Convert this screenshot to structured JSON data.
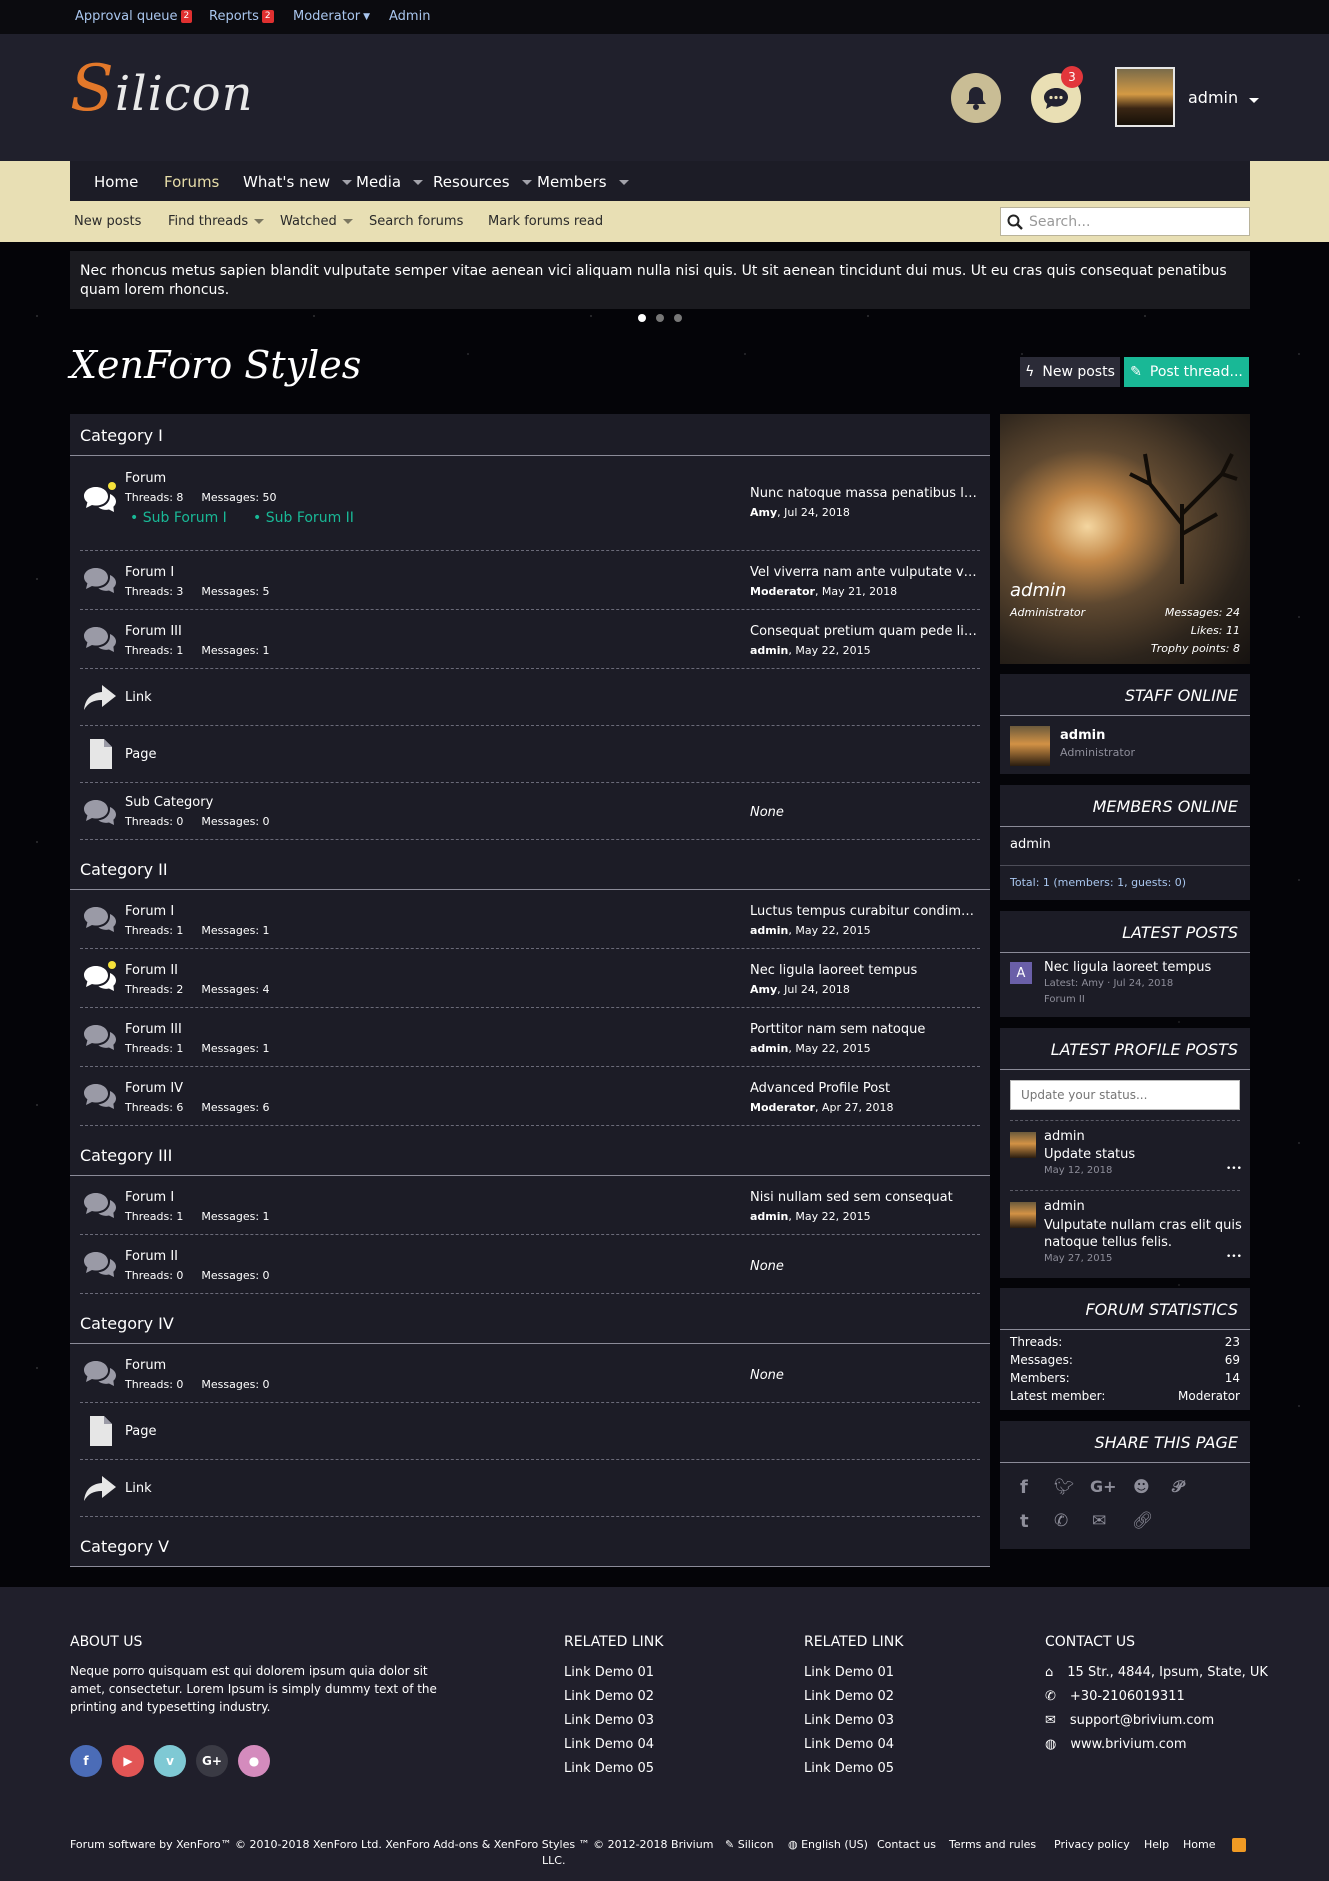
{
  "staffbar": {
    "approval_queue": "Approval queue",
    "approval_count": "2",
    "reports": "Reports",
    "reports_count": "2",
    "moderator": "Moderator",
    "admin": "Admin"
  },
  "header": {
    "logo_first": "S",
    "logo_rest": "ilicon",
    "notification_count": "3",
    "username": "admin"
  },
  "nav": {
    "home": "Home",
    "forums": "Forums",
    "whats_new": "What's new",
    "media": "Media",
    "resources": "Resources",
    "members": "Members"
  },
  "subnav": {
    "new_posts": "New posts",
    "find_threads": "Find threads",
    "watched": "Watched",
    "search_forums": "Search forums",
    "mark_read": "Mark forums read",
    "search_placeholder": "Search..."
  },
  "notice": "Nec rhoncus metus sapien blandit vulputate semper vitae aenean vici aliquam nulla nisi quis. Ut sit aenean tincidunt dui mus. Ut eu cras quis consequat penatibus quam lorem rhoncus.",
  "page": {
    "title": "XenForo Styles",
    "btn_new_posts": "New posts",
    "btn_post_thread": "Post thread..."
  },
  "categories": {
    "c1": "Category I",
    "c2": "Category II",
    "c3": "Category III",
    "c4": "Category IV",
    "c5": "Category V"
  },
  "nodes": {
    "n1": {
      "title": "Forum",
      "threads": "Threads: 8",
      "messages": "Messages: 50",
      "last": "Nunc natoque massa penatibus lorem",
      "user": "Amy",
      "date": ", Jul 24, 2018",
      "sub1": "Sub Forum I",
      "sub2": "Sub Forum II"
    },
    "n2": {
      "title": "Forum I",
      "threads": "Threads: 3",
      "messages": "Messages: 5",
      "last": "Vel viverra nam ante vulputate venenatis",
      "user": "Moderator",
      "date": ", May 21, 2018"
    },
    "n3": {
      "title": "Forum III",
      "threads": "Threads: 1",
      "messages": "Messages: 1",
      "last": "Consequat pretium quam pede libero",
      "user": "admin",
      "date": ", May 22, 2015"
    },
    "n4": {
      "title": "Link"
    },
    "n5": {
      "title": "Page"
    },
    "n6": {
      "title": "Sub Category",
      "threads": "Threads: 0",
      "messages": "Messages: 0",
      "none": "None"
    },
    "n7": {
      "title": "Forum I",
      "threads": "Threads: 1",
      "messages": "Messages: 1",
      "last": "Luctus tempus curabitur condimentum",
      "user": "admin",
      "date": ", May 22, 2015"
    },
    "n8": {
      "title": "Forum II",
      "threads": "Threads: 2",
      "messages": "Messages: 4",
      "last": "Nec ligula laoreet tempus",
      "user": "Amy",
      "date": ", Jul 24, 2018"
    },
    "n9": {
      "title": "Forum III",
      "threads": "Threads: 1",
      "messages": "Messages: 1",
      "last": "Porttitor nam sem natoque",
      "user": "admin",
      "date": ", May 22, 2015"
    },
    "n10": {
      "title": "Forum IV",
      "threads": "Threads: 6",
      "messages": "Messages: 6",
      "last": "Advanced Profile Post",
      "user": "Moderator",
      "date": ", Apr 27, 2018"
    },
    "n11": {
      "title": "Forum I",
      "threads": "Threads: 1",
      "messages": "Messages: 1",
      "last": "Nisi nullam sed sem consequat",
      "user": "admin",
      "date": ", May 22, 2015"
    },
    "n12": {
      "title": "Forum II",
      "threads": "Threads: 0",
      "messages": "Messages: 0",
      "none": "None"
    },
    "n13": {
      "title": "Forum",
      "threads": "Threads: 0",
      "messages": "Messages: 0",
      "none": "None"
    },
    "n14": {
      "title": "Page"
    },
    "n15": {
      "title": "Link"
    }
  },
  "profile_card": {
    "name": "admin",
    "role": "Administrator",
    "messages": "Messages: 24",
    "likes": "Likes: 11",
    "trophy": "Trophy points: 8"
  },
  "staff_online": {
    "title": "STAFF ONLINE",
    "name": "admin",
    "role": "Administrator"
  },
  "members_online": {
    "title": "MEMBERS ONLINE",
    "member": "admin",
    "total": "Total: 1 (members: 1, guests: 0)"
  },
  "latest_posts": {
    "title": "LATEST POSTS",
    "avatar_letter": "A",
    "post_title": "Nec ligula laoreet tempus",
    "meta": "Latest: Amy · Jul 24, 2018",
    "forum": "Forum II"
  },
  "latest_profile_posts": {
    "title": "LATEST PROFILE POSTS",
    "placeholder": "Update your status...",
    "p1": {
      "user": "admin",
      "text": "Update status",
      "date": "May 12, 2018"
    },
    "p2": {
      "user": "admin",
      "text1": "Vulputate nullam cras elit quis",
      "text2": "natoque tellus felis.",
      "date": "May 27, 2015"
    },
    "more": "•••"
  },
  "forum_stats": {
    "title": "FORUM STATISTICS",
    "threads_label": "Threads:",
    "threads": "23",
    "messages_label": "Messages:",
    "messages": "69",
    "members_label": "Members:",
    "members": "14",
    "latest_label": "Latest member:",
    "latest": "Moderator"
  },
  "share": {
    "title": "SHARE THIS PAGE"
  },
  "footer": {
    "about_title": "ABOUT US",
    "about_l1": "Neque porro quisquam est qui dolorem ipsum quia dolor sit",
    "about_l2": "amet, consectetur. Lorem Ipsum is simply dummy text of the",
    "about_l3": "printing and typesetting industry.",
    "related_title": "RELATED LINK",
    "links": [
      "Link Demo 01",
      "Link Demo 02",
      "Link Demo 03",
      "Link Demo 04",
      "Link Demo 05"
    ],
    "contact_title": "CONTACT US",
    "address": "15 Str., 4844, Ipsum, State, UK",
    "phone": "+30-2106019311",
    "email": "support@brivium.com",
    "web": "www.brivium.com",
    "copyright_l1": "Forum software by XenForo™ © 2010-2018 XenForo Ltd. XenForo Add-ons & XenForo Styles ™ © 2012-2018 Brivium",
    "copyright_l2": "LLC.",
    "style": "Silicon",
    "language": "English (US)",
    "contact": "Contact us",
    "terms": "Terms and rules",
    "privacy": "Privacy policy",
    "help": "Help",
    "home": "Home"
  },
  "colors": {
    "accent": "#19b896",
    "nav_bg": "#e8dfb4",
    "panel": "#1c1c26",
    "logo_orange": "#e3782a"
  }
}
